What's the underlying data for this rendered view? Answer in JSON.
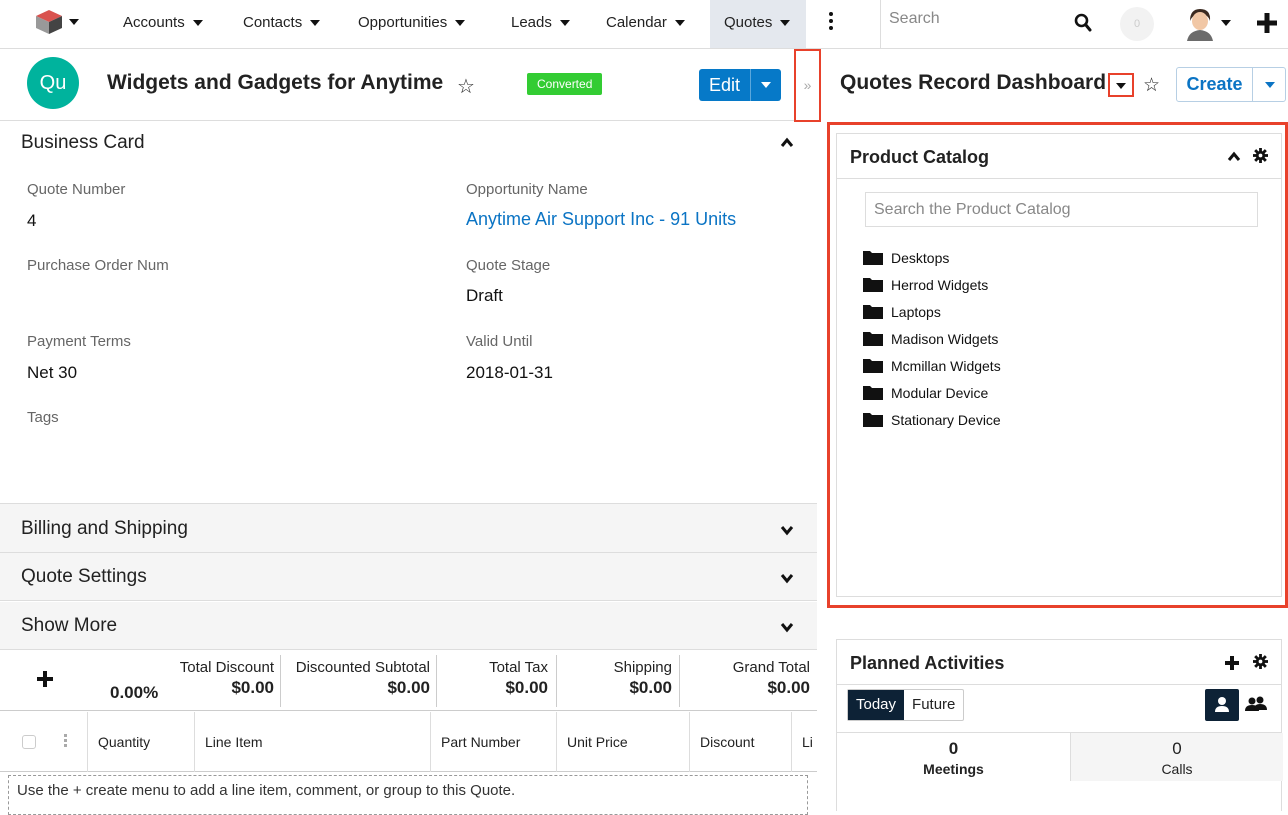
{
  "nav": {
    "items": [
      {
        "label": "Accounts"
      },
      {
        "label": "Contacts"
      },
      {
        "label": "Opportunities"
      },
      {
        "label": "Leads"
      },
      {
        "label": "Calendar"
      },
      {
        "label": "Quotes"
      }
    ],
    "search_placeholder": "Search",
    "notification_count": "0"
  },
  "record": {
    "badge": "Qu",
    "title": "Widgets and Gadgets for Anytime",
    "status": "Converted",
    "edit_label": "Edit",
    "collapse_glyph": "»"
  },
  "panels": {
    "business_card": "Business Card",
    "billing": "Billing and Shipping",
    "quote_settings": "Quote Settings",
    "show_more": "Show More"
  },
  "fields": {
    "quote_number_label": "Quote Number",
    "quote_number": "4",
    "opportunity_label": "Opportunity Name",
    "opportunity": "Anytime Air Support Inc - 91 Units",
    "po_label": "Purchase Order Num",
    "stage_label": "Quote Stage",
    "stage": "Draft",
    "payment_label": "Payment Terms",
    "payment": "Net 30",
    "valid_label": "Valid Until",
    "valid": "2018-01-31",
    "tags_label": "Tags"
  },
  "totals": {
    "discount_pct": "0.00%",
    "total_discount_label": "Total Discount",
    "total_discount": "$0.00",
    "discounted_subtotal_label": "Discounted Subtotal",
    "discounted_subtotal": "$0.00",
    "total_tax_label": "Total Tax",
    "total_tax": "$0.00",
    "shipping_label": "Shipping",
    "shipping": "$0.00",
    "grand_total_label": "Grand Total",
    "grand_total": "$0.00"
  },
  "line_items": {
    "columns": [
      "Quantity",
      "Line Item",
      "Part Number",
      "Unit Price",
      "Discount",
      "Li"
    ],
    "empty_text": "Use the + create menu to add a line item, comment, or group to this Quote."
  },
  "dashboard": {
    "title": "Quotes Record Dashboard",
    "create_label": "Create"
  },
  "product_catalog": {
    "title": "Product Catalog",
    "search_placeholder": "Search the Product Catalog",
    "folders": [
      "Desktops",
      "Herrod Widgets",
      "Laptops",
      "Madison Widgets",
      "Mcmillan Widgets",
      "Modular Device",
      "Stationary Device"
    ]
  },
  "planned_activities": {
    "title": "Planned Activities",
    "tab_today": "Today",
    "tab_future": "Future",
    "meetings_count": "0",
    "meetings_label": "Meetings",
    "calls_count": "0",
    "calls_label": "Calls"
  },
  "colors": {
    "accent": "#0679c8",
    "badge": "#00b39d",
    "status": "#33cc33",
    "highlight": "#e8412b"
  }
}
